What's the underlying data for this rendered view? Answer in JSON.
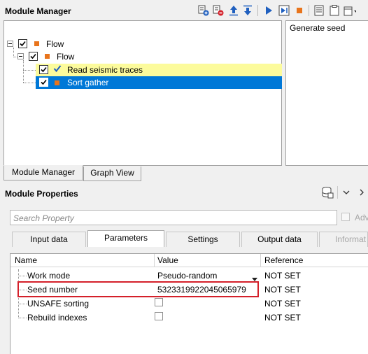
{
  "module_manager": {
    "title": "Module Manager",
    "toolbar_icons": [
      "add-module-icon",
      "remove-module-icon",
      "move-up-icon",
      "move-down-icon",
      "run-icon",
      "run-step-icon",
      "stop-icon",
      "list-icon",
      "clipboard-icon",
      "window-menu-icon"
    ],
    "tree": [
      {
        "label": "Flow",
        "level": 0,
        "checked": true,
        "icon": "orange-square-icon"
      },
      {
        "label": "Flow",
        "level": 1,
        "checked": true,
        "icon": "orange-square-icon"
      },
      {
        "label": "Read seismic traces",
        "level": 2,
        "checked": true,
        "icon": "check-mark-icon",
        "state": "highlighted-yellow"
      },
      {
        "label": "Sort gather",
        "level": 2,
        "checked": true,
        "icon": "orange-square-icon",
        "state": "selected"
      }
    ],
    "help_text": "Generate seed",
    "tabs": [
      "Module Manager",
      "Graph View"
    ],
    "active_tab": "Module Manager"
  },
  "module_properties": {
    "title": "Module Properties",
    "search_placeholder": "Search Property",
    "advanced_label": "Adv",
    "tabs": [
      "Input data",
      "Parameters",
      "Settings",
      "Output data",
      "Informat"
    ],
    "active_tab": "Parameters",
    "columns": [
      "Name",
      "Value",
      "Reference"
    ],
    "rows": [
      {
        "name": "Work mode",
        "value": "Pseudo-random",
        "type": "dropdown",
        "reference": "NOT SET"
      },
      {
        "name": "Seed number",
        "value": "5323319922045065979",
        "type": "text",
        "reference": "NOT SET",
        "highlighted": true
      },
      {
        "name": "UNSAFE sorting",
        "value": "",
        "type": "checkbox",
        "checked": false,
        "reference": "NOT SET"
      },
      {
        "name": "Rebuild indexes",
        "value": "",
        "type": "checkbox",
        "checked": false,
        "reference": "NOT SET"
      }
    ]
  },
  "colors": {
    "selection": "#0078d7",
    "row_highlight": "#fcfb9c",
    "flow_icon": "#e8741c",
    "callout": "#d4202a",
    "toolbar_blue": "#1f5fbf"
  }
}
